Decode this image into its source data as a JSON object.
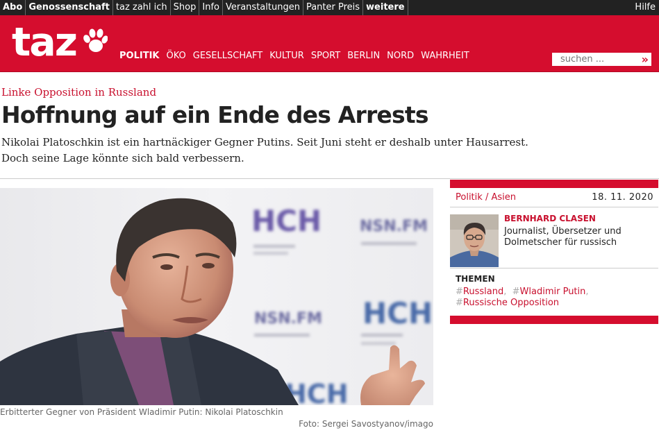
{
  "topbar": {
    "links": [
      "Abo",
      "Genossenschaft",
      "taz zahl ich",
      "Shop",
      "Info",
      "Veranstaltungen",
      "Panter Preis",
      "weitere"
    ],
    "help": "Hilfe"
  },
  "masthead": {
    "logo": "taz",
    "nav": [
      "POLITIK",
      "ÖKO",
      "GESELLSCHAFT",
      "KULTUR",
      "SPORT",
      "BERLIN",
      "NORD",
      "WAHRHEIT"
    ],
    "search_placeholder": "suchen ...",
    "search_go": "»"
  },
  "article": {
    "kicker": "Linke Opposition in Russland",
    "headline": "Hoffnung auf ein Ende des Arrests",
    "teaser_line1": "Nikolai Platoschkin ist ein hartnäckiger Gegner Putins. Seit Juni steht er deshalb unter Hausarrest.",
    "teaser_line2": "Doch seine Lage könnte sich bald verbessern.",
    "photo": {
      "caption": "Erbitterter Gegner von Präsident Wladimir Putin: Nikolai Platoschkin",
      "credit": "Foto: Sergei Savostyanov/imago",
      "backdrop_logos": [
        "НСН",
        "NSN.FM"
      ]
    }
  },
  "sidebar": {
    "category": "Politik",
    "category_sep": "/",
    "subcategory": "Asien",
    "date": "18. 11. 2020",
    "author_name": "BERNHARD CLASEN",
    "author_bio": "Journalist, Übersetzer und Dolmetscher für russisch",
    "themes_heading": "THEMEN",
    "tags": [
      "Russland",
      "Wladimir Putin",
      "Russische Opposition"
    ]
  },
  "colors": {
    "brand_red": "#d50d2e",
    "topbar": "#222222"
  }
}
